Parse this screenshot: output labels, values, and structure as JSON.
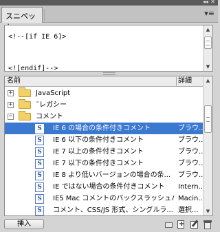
{
  "panel": {
    "tab_label": "スニペット",
    "collapse_glyph": "◂◂",
    "close_glyph": "✕",
    "menu_glyph": "▾≡"
  },
  "preview": {
    "line1": "<!--[if IE 6]>",
    "line2": "<![endif]-->"
  },
  "list": {
    "header_name": "名前",
    "header_detail": "詳細",
    "rows": [
      {
        "kind": "folder",
        "expander": "+",
        "name": "JavaScript"
      },
      {
        "kind": "folder",
        "expander": "+",
        "name": "˜レガシー"
      },
      {
        "kind": "folder",
        "expander": "−",
        "name": "コメント"
      },
      {
        "kind": "snippet",
        "name": "IE 6 の場合の条件付きコメント",
        "detail": "ブラウ...",
        "selected": true
      },
      {
        "kind": "snippet",
        "name": "IE 6 以下の条件付きコメント",
        "detail": "ブラウ..."
      },
      {
        "kind": "snippet",
        "name": "IE 7 以上の条件付きコメント",
        "detail": "ブラウ..."
      },
      {
        "kind": "snippet",
        "name": "IE 7 以下の条件付きコメント",
        "detail": "ブラウ..."
      },
      {
        "kind": "snippet",
        "name": "IE 8 より低いバージョンの場合の条...",
        "detail": "ブラウ..."
      },
      {
        "kind": "snippet",
        "name": "IE ではない場合の条件付きコメント",
        "detail": "Intern..."
      },
      {
        "kind": "snippet",
        "name": "IE5 Mac コメントのバックスラッシュハ...",
        "detail": "Macin..."
      },
      {
        "kind": "snippet",
        "name": "コメント、CSS/JS 形式、シングルラ...",
        "detail": "選択..."
      }
    ],
    "snippet_glyph": "S"
  },
  "footer": {
    "insert_label": "挿入",
    "new_snippet_glyph": "+"
  }
}
